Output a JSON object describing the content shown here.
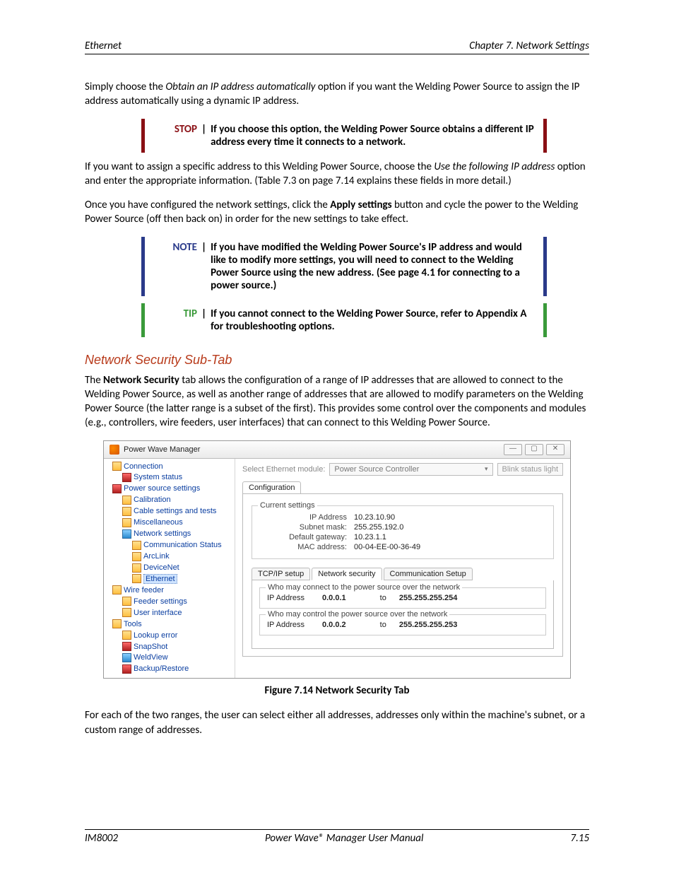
{
  "header": {
    "left": "Ethernet",
    "right": "Chapter 7. Network Settings"
  },
  "p1_a": "Simply choose the ",
  "p1_em": "Obtain an IP address automatically",
  "p1_b": " option if you want the Welding Power Source to assign the IP address automatically using a dynamic IP address.",
  "stop": {
    "label": "STOP",
    "text": "If you choose this option, the Welding Power Source obtains a different IP address every time it connects to a network."
  },
  "p2_a": "If you want to assign a specific address to this Welding Power Source, choose the ",
  "p2_em": "Use the following IP address",
  "p2_b": " option and enter the appropriate information.  (Table 7.3 on page 7.14 explains these fields in more detail.)",
  "p3_a": "Once you have configured the network settings, click the ",
  "p3_b": "Apply settings",
  "p3_c": " button and cycle the power to the Welding Power Source (off then back on) in order for the new settings to take effect.",
  "note": {
    "label": "NOTE",
    "text": "If you have modified the Welding Power Source's IP address and would like to modify more settings, you will need to connect to the Welding Power Source using the new address.  (See page 4.1 for connecting to a power source.)"
  },
  "tip": {
    "label": "TIP",
    "text": "If you cannot connect to the Welding Power Source, refer to Appendix A for troubleshooting options."
  },
  "h2": "Network Security Sub-Tab",
  "p4_a": "The ",
  "p4_b": "Network Security",
  "p4_c": " tab allows the configuration of a range of IP addresses that are allowed to connect to the Welding Power Source, as well as another range of addresses that are allowed to modify parameters on the Welding Power Source (the latter range is a subset of the first).  This provides some control over the components and modules (e.g., controllers, wire feeders, user interfaces) that can connect to this Welding Power Source.",
  "shot": {
    "title": "Power Wave Manager",
    "tree": [
      {
        "lvl": 1,
        "t": "Connection",
        "ico": ""
      },
      {
        "lvl": 2,
        "t": "System status",
        "ico": "red"
      },
      {
        "lvl": 1,
        "t": "Power source settings",
        "ico": "red"
      },
      {
        "lvl": 2,
        "t": "Calibration",
        "ico": ""
      },
      {
        "lvl": 2,
        "t": "Cable settings and tests",
        "ico": ""
      },
      {
        "lvl": 2,
        "t": "Miscellaneous",
        "ico": ""
      },
      {
        "lvl": 2,
        "t": "Network settings",
        "ico": "net"
      },
      {
        "lvl": 3,
        "t": "Communication Status",
        "ico": ""
      },
      {
        "lvl": 3,
        "t": "ArcLink",
        "ico": ""
      },
      {
        "lvl": 3,
        "t": "DeviceNet",
        "ico": ""
      },
      {
        "lvl": 3,
        "t": "Ethernet",
        "ico": "",
        "sel": true
      },
      {
        "lvl": 1,
        "t": "Wire feeder",
        "ico": ""
      },
      {
        "lvl": 2,
        "t": "Feeder settings",
        "ico": ""
      },
      {
        "lvl": 2,
        "t": "User interface",
        "ico": ""
      },
      {
        "lvl": 1,
        "t": "Tools",
        "ico": ""
      },
      {
        "lvl": 2,
        "t": "Lookup error",
        "ico": ""
      },
      {
        "lvl": 2,
        "t": "SnapShot",
        "ico": "red"
      },
      {
        "lvl": 2,
        "t": "WeldView",
        "ico": "net"
      },
      {
        "lvl": 2,
        "t": "Backup/Restore",
        "ico": "red"
      }
    ],
    "select_label": "Select Ethernet module:",
    "select_value": "Power Source Controller",
    "blink_btn": "Blink status light",
    "tab_config": "Configuration",
    "grp_current": "Current settings",
    "kv": {
      "ip_k": "IP Address",
      "ip_v": "10.23.10.90",
      "sn_k": "Subnet mask:",
      "sn_v": "255.255.192.0",
      "gw_k": "Default gateway:",
      "gw_v": "10.23.1.1",
      "mac_k": "MAC address:",
      "mac_v": "00-04-EE-00-36-49"
    },
    "subtabs": {
      "a": "TCP/IP setup",
      "b": "Network security",
      "c": "Communication Setup"
    },
    "box1_legend": "Who may connect to the power source over the network",
    "box2_legend": "Who may control the power source over the network",
    "rng_lbl": "IP Address",
    "rng_to": "to",
    "rng1_from": "0.0.0.1",
    "rng1_to": "255.255.255.254",
    "rng2_from": "0.0.0.2",
    "rng2_to": "255.255.255.253"
  },
  "fig_caption": "Figure 7.14   Network Security Tab",
  "p5": "For each of the two ranges, the user can select either all addresses, addresses only within the machine's subnet, or a custom range of addresses.",
  "footer": {
    "left": "IM8002",
    "mid": "Power Wave® Manager User Manual",
    "right": "7.15"
  }
}
